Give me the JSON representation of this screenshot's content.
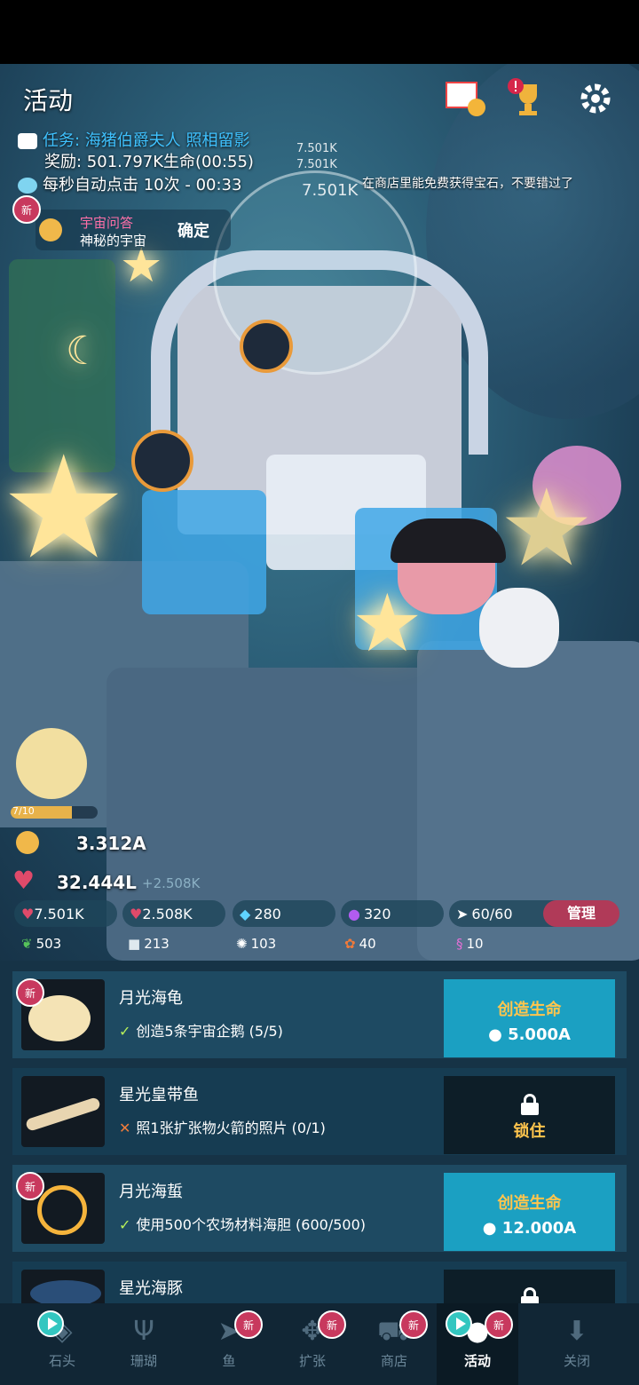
{
  "header": {
    "activity_label": "活动",
    "task_prefix": "任务: ",
    "task_text": "海猪伯爵夫人 照相留影",
    "reward_text": "奖励: 501.797K生命(00:55)",
    "auto_click_text": "每秒自动点击 10次 - 00:33",
    "shop_ticker": "在商店里能免费获得宝石，不要错过了",
    "floating_numbers": [
      "7.501K",
      "7.501K",
      "7.501K"
    ]
  },
  "quiz": {
    "badge": "新",
    "title": "宇宙问答",
    "subtitle": "神秘的宇宙",
    "confirm": "确定"
  },
  "stats": {
    "level": "7/10",
    "level_progress": 0.7,
    "currency": "3.312A",
    "life": "32.444L",
    "life_rate": "+2.508K"
  },
  "resources": {
    "tap_value": "7.501K",
    "life_per_sec": "2.508K",
    "gems": "280",
    "purple_orbs": "320",
    "fish_count": "60/60",
    "manage": "管理",
    "seaweed": "503",
    "stone": "213",
    "urchin": "103",
    "shrimp": "40",
    "seahorse": "10"
  },
  "list": {
    "items": [
      {
        "badge": "新",
        "title": "月光海龟",
        "status": "done",
        "requirement": "创造5条宇宙企鹅 (5/5)",
        "button": "创造生命",
        "cost": "5.000A"
      },
      {
        "badge": "",
        "title": "星光皇带鱼",
        "status": "locked",
        "requirement": "照1张扩张物火箭的照片 (0/1)",
        "button": "锁住",
        "cost": ""
      },
      {
        "badge": "新",
        "title": "月光海蜇",
        "status": "done",
        "requirement": "使用500个农场材料海胆 (600/500)",
        "button": "创造生命",
        "cost": "12.000A"
      },
      {
        "badge": "",
        "title": "星光海豚",
        "status": "locked",
        "requirement": "",
        "button": "",
        "cost": ""
      }
    ]
  },
  "nav": {
    "items": [
      {
        "label": "石头",
        "badge": "",
        "icon": "rock-icon"
      },
      {
        "label": "珊瑚",
        "badge": "",
        "icon": "coral-icon"
      },
      {
        "label": "鱼",
        "badge": "新",
        "icon": "fish-icon"
      },
      {
        "label": "扩张",
        "badge": "新",
        "icon": "expand-icon"
      },
      {
        "label": "商店",
        "badge": "新",
        "icon": "cart-icon"
      },
      {
        "label": "活动",
        "badge": "新",
        "icon": "event-icon"
      },
      {
        "label": "关闭",
        "badge": "",
        "icon": "close-down-icon"
      }
    ]
  },
  "colors": {
    "accent_blue": "#1ba0c2",
    "badge_pink": "#c8395e",
    "gold": "#ffc54d",
    "task_blue": "#3fc2ff"
  }
}
